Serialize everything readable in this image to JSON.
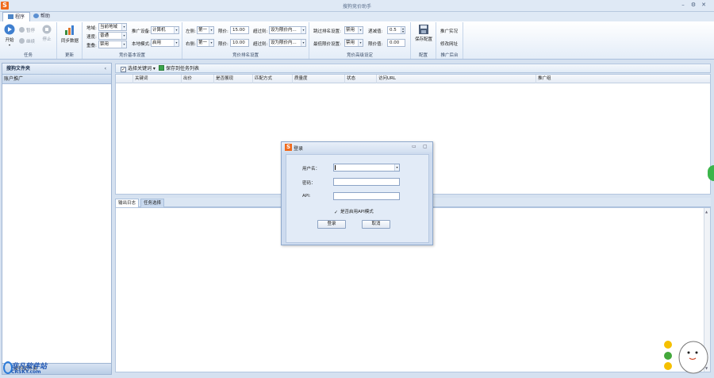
{
  "window": {
    "title": "搜狗竞价助手",
    "icon_letter": "S"
  },
  "ribbon_tabs": [
    {
      "label": "程序",
      "active": true
    },
    {
      "label": "帮助",
      "active": false
    }
  ],
  "ribbon": {
    "task": {
      "group_label": "任务",
      "start_label": "开始",
      "pause_label": "暂停",
      "resume_label": "继续",
      "stop_label": "停止"
    },
    "update": {
      "group_label": "更新",
      "sync_label": "同步数据"
    },
    "basic": {
      "group_label": "竞价基本设置",
      "region_label": "地域:",
      "region_value": "当前地域",
      "speed_label": "速度:",
      "speed_value": "普通",
      "overlap_label": "重叠:",
      "overlap_value": "禁用",
      "device_label": "推广设备:",
      "device_value": "计算机",
      "local_mode_label": "本地模式:",
      "local_mode_value": "启用"
    },
    "rank": {
      "group_label": "竞价排名设置",
      "left_label": "左侧:",
      "left_value": "第一",
      "right_label": "右侧:",
      "right_value": "第一",
      "limit1_label": "限价:",
      "limit1_value": "15.00",
      "limit2_label": "限价:",
      "limit2_value": "10.00",
      "over1_label": "超过则:",
      "over1_value": "设为限价内...",
      "over2_label": "超过则:",
      "over2_value": "设为限价内..."
    },
    "advanced": {
      "group_label": "竞价高级设定",
      "skip_label": "跳过排名设置:",
      "skip_value": "禁用",
      "lowest_label": "最低限价设置:",
      "lowest_value": "禁用",
      "decrement_label": "递减值:",
      "decrement_value": "0.5",
      "limit_label": "限价值:",
      "limit_value": "0.00"
    },
    "config": {
      "group_label": "配置",
      "save_label": "保存配置"
    },
    "backend": {
      "group_label": "推广后台",
      "live_label": "推广实况",
      "modify_label": "修改网址"
    }
  },
  "left_panel": {
    "title": "搜狗文件夹",
    "collapse_glyph": "‹",
    "item": "账户推广",
    "bottom_label": "搜狗文件夹"
  },
  "toolbar": {
    "select_keywords": "选择关键词",
    "save_to_tasks": "保存到任务列表"
  },
  "grid": {
    "columns": [
      "关键词",
      "出价",
      "是否展现",
      "匹配方式",
      "质量度",
      "状态",
      "访问URL",
      "推广组"
    ]
  },
  "bottom_tabs": [
    {
      "label": "输出日志",
      "active": true
    },
    {
      "label": "任务选择",
      "active": false
    }
  ],
  "login_dialog": {
    "title": "登录",
    "icon_letter": "S",
    "username_label": "用户名：",
    "username_value": "",
    "password_label": "密码：",
    "password_value": "",
    "api_label": "API:",
    "api_value": "",
    "api_mode_label": "是否启用API模式",
    "api_mode_checked": true,
    "login_button": "登录",
    "cancel_button": "取消"
  },
  "watermark": {
    "line1": "非凡软件站",
    "line2": "CRSKY.com"
  },
  "colors": {
    "accent": "#f06a1c",
    "ribbon_bg": "#dfe9f5",
    "border": "#9fb5d3"
  }
}
